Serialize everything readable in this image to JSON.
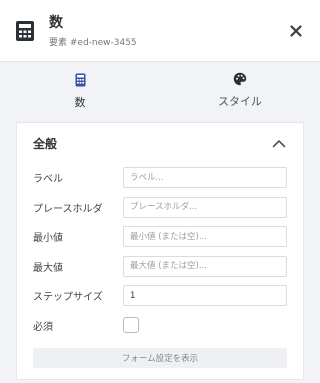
{
  "header": {
    "title": "数",
    "subtitle": "要素 #ed-new-3455",
    "icon": "calculator-icon",
    "close_icon": "close-icon"
  },
  "tabs": [
    {
      "label": "数",
      "icon": "calculator-icon",
      "active": true
    },
    {
      "label": "スタイル",
      "icon": "palette-icon",
      "active": false
    }
  ],
  "section": {
    "title": "全般",
    "collapse_icon": "chevron-up-icon"
  },
  "fields": {
    "label": {
      "label": "ラベル",
      "value": "",
      "placeholder": "ラベル..."
    },
    "placeholder": {
      "label": "プレースホルダ",
      "value": "",
      "placeholder": "プレースホルダ..."
    },
    "min": {
      "label": "最小値",
      "value": "",
      "placeholder": "最小値 (または空)..."
    },
    "max": {
      "label": "最大値",
      "value": "",
      "placeholder": "最大値 (または空)..."
    },
    "step": {
      "label": "ステップサイズ",
      "value": "1",
      "placeholder": ""
    },
    "required": {
      "label": "必須",
      "checked": false
    }
  },
  "form_settings_button": "フォーム設定を表示",
  "colors": {
    "accent": "#3a4fa0",
    "icon_dark": "#2b2f36",
    "background": "#f1f3f6"
  }
}
